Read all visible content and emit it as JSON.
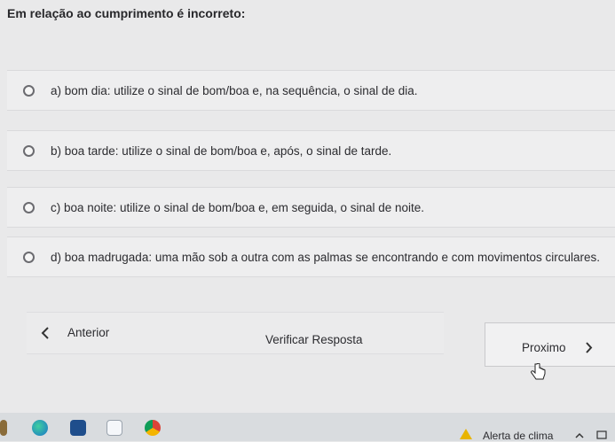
{
  "question": "Em relação ao cumprimento é incorreto:",
  "options": [
    {
      "label": "a) bom dia: utilize o sinal de bom/boa e, na sequência, o sinal de dia."
    },
    {
      "label": "b) boa tarde: utilize o sinal de bom/boa e, após, o sinal de tarde."
    },
    {
      "label": "c) boa noite: utilize o sinal de bom/boa e, em seguida, o sinal de noite."
    },
    {
      "label": "d) boa madrugada: uma mão sob a outra com as palmas se encontrando e com movimentos circulares."
    }
  ],
  "nav": {
    "previous_label": "Anterior",
    "verify_label": "Verificar Resposta",
    "next_label": "Proximo"
  },
  "taskbar": {
    "weather_label": "Alerta de clima"
  },
  "icons": {
    "prev": "chevron-left-icon",
    "next": "chevron-right-icon",
    "cursor": "hand-pointer-icon"
  },
  "colors": {
    "background": "#e9e9ea",
    "option_background": "#eeeeef",
    "taskbar": "#d9dcdf"
  }
}
